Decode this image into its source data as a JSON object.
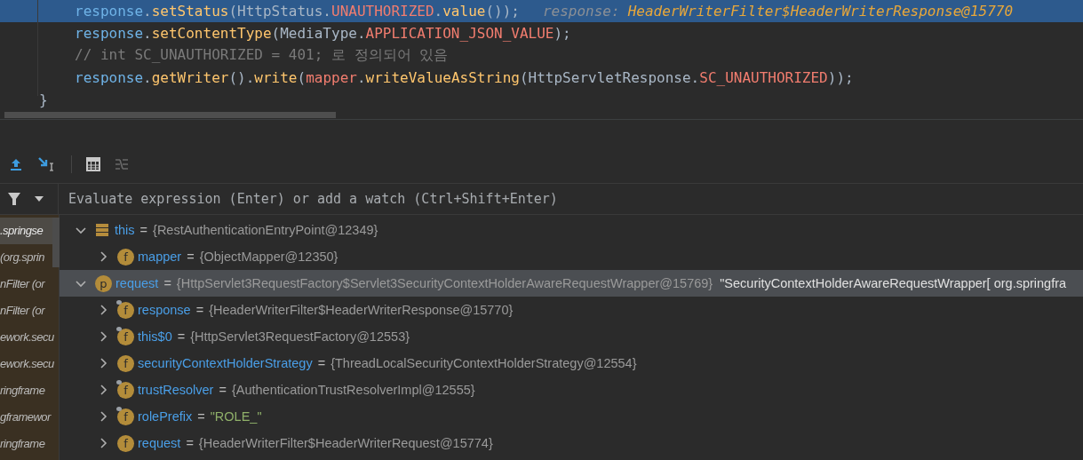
{
  "editor": {
    "lines": [
      {
        "highlighted": true,
        "indented": true,
        "tokens": [
          {
            "kind": "var",
            "text": "response"
          },
          {
            "kind": "plain",
            "text": "."
          },
          {
            "kind": "method",
            "text": "setStatus"
          },
          {
            "kind": "plain",
            "text": "(HttpStatus."
          },
          {
            "kind": "const",
            "text": "UNAUTHORIZED"
          },
          {
            "kind": "plain",
            "text": "."
          },
          {
            "kind": "method",
            "text": "value"
          },
          {
            "kind": "plain",
            "text": "());"
          }
        ],
        "hint_label": "response:",
        "hint_value": "HeaderWriterFilter$HeaderWriterResponse@15770"
      },
      {
        "highlighted": false,
        "indented": true,
        "tokens": [
          {
            "kind": "var",
            "text": "response"
          },
          {
            "kind": "plain",
            "text": "."
          },
          {
            "kind": "method",
            "text": "setContentType"
          },
          {
            "kind": "plain",
            "text": "(MediaType."
          },
          {
            "kind": "const",
            "text": "APPLICATION_JSON_VALUE"
          },
          {
            "kind": "plain",
            "text": ");"
          }
        ]
      },
      {
        "highlighted": false,
        "indented": true,
        "tokens": [
          {
            "kind": "comment",
            "text": "// int SC_UNAUTHORIZED = 401; 로 정의되어 있음"
          }
        ]
      },
      {
        "highlighted": false,
        "indented": true,
        "tokens": [
          {
            "kind": "var",
            "text": "response"
          },
          {
            "kind": "plain",
            "text": "."
          },
          {
            "kind": "method",
            "text": "getWriter"
          },
          {
            "kind": "plain",
            "text": "()."
          },
          {
            "kind": "method",
            "text": "write"
          },
          {
            "kind": "plain",
            "text": "("
          },
          {
            "kind": "field",
            "text": "mapper"
          },
          {
            "kind": "plain",
            "text": "."
          },
          {
            "kind": "method",
            "text": "writeValueAsString"
          },
          {
            "kind": "plain",
            "text": "(HttpServletResponse."
          },
          {
            "kind": "const",
            "text": "SC_UNAUTHORIZED"
          },
          {
            "kind": "plain",
            "text": "));"
          }
        ]
      },
      {
        "highlighted": false,
        "indented": false,
        "tokens": [
          {
            "kind": "plain",
            "text": "}"
          }
        ]
      }
    ]
  },
  "debugger": {
    "watch_field": {
      "placeholder": "Evaluate expression (Enter) or add a watch (Ctrl+Shift+Enter)"
    },
    "frames": [
      {
        "text": ".springse",
        "selected": true
      },
      {
        "text": "*(org.sprin*",
        "selected": false
      },
      {
        "text": "nFilter *(or*",
        "selected": false
      },
      {
        "text": "nFilter *(or*",
        "selected": false
      },
      {
        "text": "ework.secu",
        "selected": false
      },
      {
        "text": "ework.secu",
        "selected": false
      },
      {
        "text": "ringframe",
        "selected": false
      },
      {
        "text": "gframewor",
        "selected": false
      },
      {
        "text": "ringframe",
        "selected": false
      }
    ],
    "variables": [
      {
        "kind": "object",
        "name": "this",
        "separator": "=",
        "value": "{RestAuthenticationEntryPoint@12349}",
        "expanded": true,
        "selected": false,
        "children": [
          {
            "kind": "field",
            "badge": "f",
            "final": false,
            "name": "mapper",
            "separator": "=",
            "value": "{ObjectMapper@12350}",
            "expanded": false,
            "selected": false
          }
        ]
      },
      {
        "kind": "parameter",
        "badge": "p",
        "final": false,
        "name": "request",
        "separator": "=",
        "value": "{HttpServlet3RequestFactory$Servlet3SecurityContextHolderAwareRequestWrapper@15769}",
        "string_value": "\"SecurityContextHolderAwareRequestWrapper[ org.springfra",
        "expanded": true,
        "selected": true,
        "children": [
          {
            "kind": "field",
            "badge": "f",
            "final": true,
            "name": "response",
            "separator": "=",
            "value": "{HeaderWriterFilter$HeaderWriterResponse@15770}",
            "expanded": false,
            "selected": false
          },
          {
            "kind": "field",
            "badge": "f",
            "final": true,
            "name": "this$0",
            "separator": "=",
            "value": "{HttpServlet3RequestFactory@12553}",
            "expanded": false,
            "selected": false
          },
          {
            "kind": "field",
            "badge": "f",
            "final": false,
            "name": "securityContextHolderStrategy",
            "separator": "=",
            "value": "{ThreadLocalSecurityContextHolderStrategy@12554}",
            "expanded": false,
            "selected": false
          },
          {
            "kind": "field",
            "badge": "f",
            "final": true,
            "name": "trustResolver",
            "separator": "=",
            "value": "{AuthenticationTrustResolverImpl@12555}",
            "expanded": false,
            "selected": false
          },
          {
            "kind": "field",
            "badge": "f",
            "final": true,
            "name": "rolePrefix",
            "separator": "=",
            "string_value": "\"ROLE_\"",
            "expanded": false,
            "selected": false
          },
          {
            "kind": "field",
            "badge": "f",
            "final": false,
            "name": "request",
            "separator": "=",
            "value": "{HeaderWriterFilter$HeaderWriterRequest@15774}",
            "expanded": false,
            "selected": false
          }
        ]
      }
    ]
  }
}
